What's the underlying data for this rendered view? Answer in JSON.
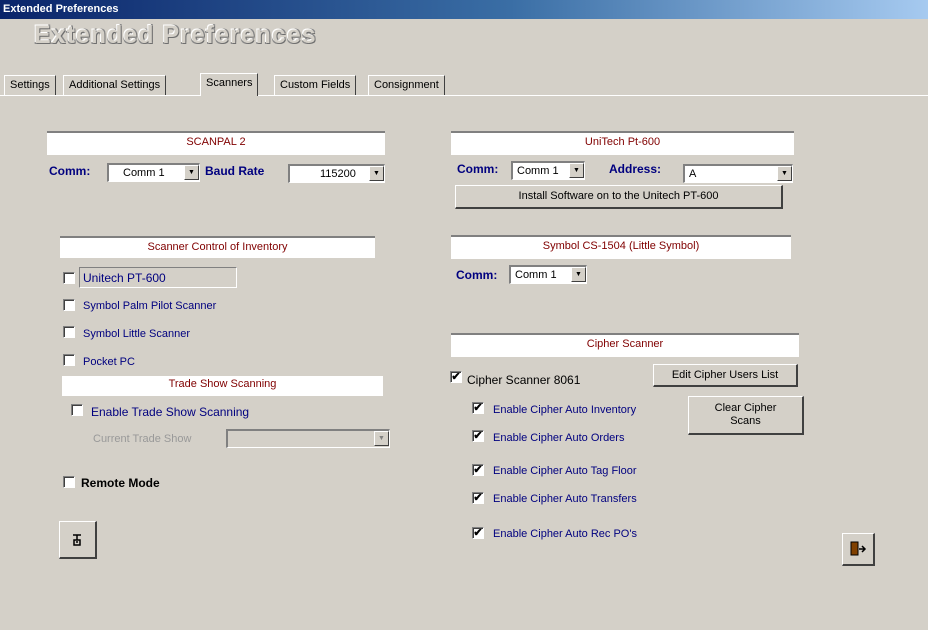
{
  "window": {
    "title": "Extended Preferences",
    "heading": "Extended Preferences"
  },
  "tabs": [
    {
      "label": "Settings"
    },
    {
      "label": "Additional Settings"
    },
    {
      "label": "Scanners",
      "active": true
    },
    {
      "label": "Custom Fields"
    },
    {
      "label": "Consignment"
    }
  ],
  "scanpal": {
    "header": "SCANPAL 2",
    "comm_label": "Comm:",
    "comm_value": "Comm 1",
    "baud_label": "Baud Rate",
    "baud_value": "115200"
  },
  "unitech": {
    "header": "UniTech Pt-600",
    "comm_label": "Comm:",
    "comm_value": "Comm 1",
    "address_label": "Address:",
    "address_value": "A",
    "install_button": "Install Software on to the Unitech PT-600"
  },
  "symbol": {
    "header": "Symbol CS-1504 (Little Symbol)",
    "comm_label": "Comm:",
    "comm_value": "Comm 1"
  },
  "inventory_control": {
    "header": "Scanner Control of Inventory",
    "options": [
      {
        "label": "Unitech PT-600",
        "checked": false
      },
      {
        "label": "Symbol Palm Pilot Scanner",
        "checked": false
      },
      {
        "label": "Symbol Little Scanner",
        "checked": false
      },
      {
        "label": "Pocket PC",
        "checked": false
      }
    ]
  },
  "trade_show": {
    "header": "Trade Show Scanning",
    "enable_label": "Enable Trade Show Scanning",
    "current_label": "Current Trade Show",
    "current_value": ""
  },
  "remote_mode": {
    "label": "Remote Mode",
    "checked": false
  },
  "cipher": {
    "header": "Cipher Scanner",
    "scanner_label": "Cipher Scanner 8061",
    "edit_users_button": "Edit Cipher Users List",
    "clear_scans_button_line1": "Clear Cipher",
    "clear_scans_button_line2": "Scans",
    "options": [
      {
        "label": "Enable Cipher Auto Inventory",
        "checked": true
      },
      {
        "label": "Enable Cipher Auto Orders",
        "checked": true
      },
      {
        "label": "Enable Cipher Auto Tag Floor",
        "checked": true
      },
      {
        "label": "Enable Cipher Auto Transfers",
        "checked": true
      },
      {
        "label": "Enable Cipher Auto Rec PO's",
        "checked": true
      }
    ]
  },
  "check_mark": "✔",
  "arrow_glyph": "▼",
  "icons": {
    "left_button": "tools-icon",
    "right_button": "exit-door-icon"
  },
  "colors": {
    "header_text": "#800000",
    "label_blue": "#00007f",
    "titlebar": "#0a246a"
  }
}
